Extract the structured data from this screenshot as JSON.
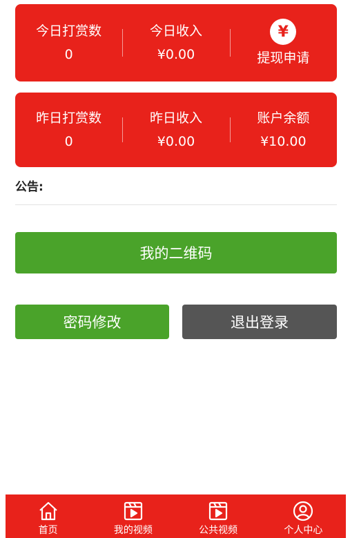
{
  "today": {
    "tips_label": "今日打赏数",
    "tips_value": "0",
    "income_label": "今日收入",
    "income_value": "¥0.00",
    "withdraw_icon": "¥",
    "withdraw_label": "提现申请"
  },
  "yesterday": {
    "tips_label": "昨日打赏数",
    "tips_value": "0",
    "income_label": "昨日收入",
    "income_value": "¥0.00",
    "balance_label": "账户余额",
    "balance_value": "¥10.00"
  },
  "notice": {
    "label": "公告:"
  },
  "buttons": {
    "qr_code": "我的二维码",
    "change_password": "密码修改",
    "logout": "退出登录"
  },
  "tabbar": {
    "items": [
      {
        "label": "首页",
        "icon": "home-icon"
      },
      {
        "label": "我的视频",
        "icon": "video-icon"
      },
      {
        "label": "公共视频",
        "icon": "video-icon"
      },
      {
        "label": "个人中心",
        "icon": "user-icon"
      }
    ]
  },
  "colors": {
    "brand_red": "#e8221b",
    "green": "#4aa32a",
    "dark_gray": "#555555"
  }
}
